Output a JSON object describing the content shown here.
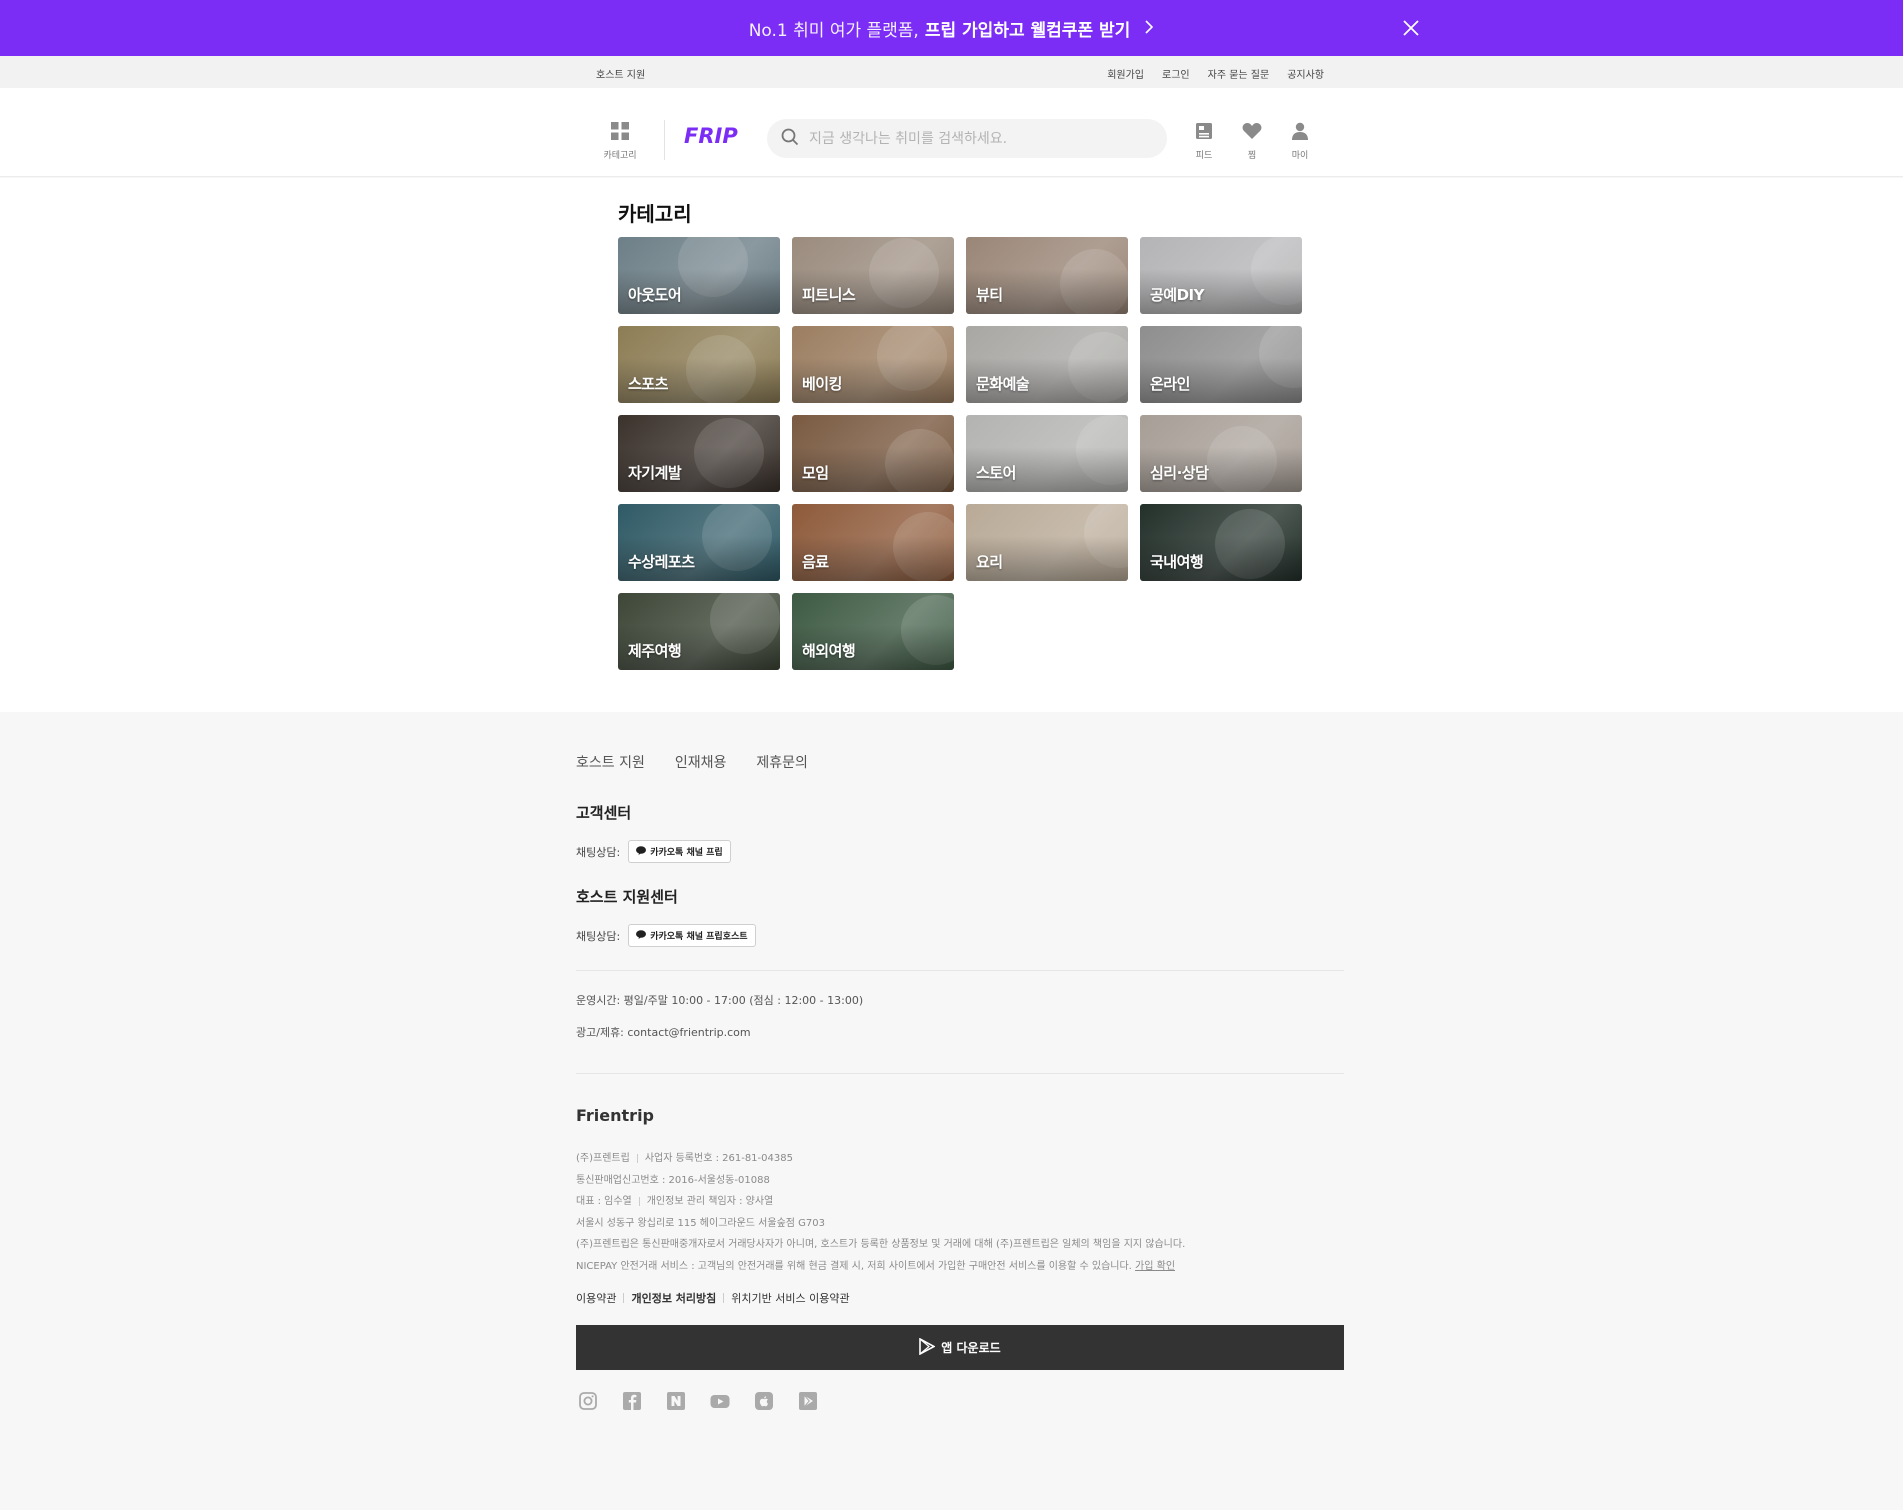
{
  "promo": {
    "text_plain": "No.1 취미 여가 플랫폼,",
    "text_bold": "프립 가입하고 웰컴쿠폰 받기",
    "chevron": "chevron-right-icon",
    "close": "close-icon",
    "background": "#7b2cf5"
  },
  "util_bar": {
    "host_support": "호스트 지원",
    "links": [
      "회원가입",
      "로그인",
      "자주 묻는 질문",
      "공지사항"
    ]
  },
  "header": {
    "category_label": "카테고리",
    "logo_text": "FRIP",
    "brand_color": "#7b2cf5",
    "search_placeholder": "지금 생각나는 취미를 검색하세요.",
    "icons": [
      {
        "label": "피드",
        "icon": "feed-icon"
      },
      {
        "label": "찜",
        "icon": "heart-icon"
      },
      {
        "label": "마이",
        "icon": "user-icon"
      }
    ]
  },
  "main": {
    "title": "카테고리",
    "categories": [
      {
        "label": "아웃도어",
        "color": "#6d7f87"
      },
      {
        "label": "피트니스",
        "color": "#9a8b7d"
      },
      {
        "label": "뷰티",
        "color": "#9a8677"
      },
      {
        "label": "공예DIY",
        "color": "#b4b4b6"
      },
      {
        "label": "스포츠",
        "color": "#8d7d55"
      },
      {
        "label": "베이킹",
        "color": "#9c7e61"
      },
      {
        "label": "문화예술",
        "color": "#a9a7a4"
      },
      {
        "label": "온라인",
        "color": "#8e8e8e"
      },
      {
        "label": "자기계발",
        "color": "#3b322c"
      },
      {
        "label": "모임",
        "color": "#7a5a41"
      },
      {
        "label": "스토어",
        "color": "#b3b3b1"
      },
      {
        "label": "심리·상담",
        "color": "#a79e96"
      },
      {
        "label": "수상레포츠",
        "color": "#2f5a66"
      },
      {
        "label": "음료",
        "color": "#8e5a3a"
      },
      {
        "label": "요리",
        "color": "#b9aa97"
      },
      {
        "label": "국내여행",
        "color": "#23302a"
      },
      {
        "label": "제주여행",
        "color": "#3d4637"
      },
      {
        "label": "해외여행",
        "color": "#3d5a43"
      }
    ]
  },
  "footer": {
    "links": [
      "호스트 지원",
      "인재채용",
      "제휴문의"
    ],
    "customer_center": {
      "title": "고객센터",
      "chat_label": "채팅상담:",
      "button": "카카오톡 채널 프립"
    },
    "host_center": {
      "title": "호스트 지원센터",
      "chat_label": "채팅상담:",
      "button": "카카오톡 채널 프립호스트"
    },
    "hours": "운영시간: 평일/주말 10:00 - 17:00 (점심 : 12:00 - 13:00)",
    "ad_contact": "광고/제휴: contact@frientrip.com",
    "brand": "Frientrip",
    "legal": {
      "company": "(주)프렌트립",
      "biz_no": "사업자 등록번호 : 261-81-04385",
      "mail_order": "통신판매업신고번호 : 2016-서울성동-01088",
      "ceo": "대표 : 임수열",
      "privacy_officer": "개인정보 관리 책임자 : 양사열",
      "address": "서울시 성동구 왕십리로 115 헤이그라운드 서울숲점 G703",
      "disclaimer": "(주)프렌트립은 통신판매중개자로서 거래당사자가 아니며, 호스트가 등록한 상품정보 및 거래에 대해 (주)프렌트립은 일체의 책임을 지지 않습니다.",
      "nicepay": "NICEPAY 안전거래 서비스 : 고객님의 안전거래를 위해 현금 결제 시, 저희 사이트에서 가입한 구매안전 서비스를 이용할 수 있습니다.",
      "confirm": "가입 확인"
    },
    "policies": [
      "이용약관",
      "개인정보 처리방침",
      "위치기반 서비스 이용약관"
    ],
    "app_download": "앱 다운로드",
    "social": [
      "instagram-icon",
      "facebook-icon",
      "naver-blog-icon",
      "youtube-icon",
      "apple-store-icon",
      "google-play-icon"
    ]
  }
}
